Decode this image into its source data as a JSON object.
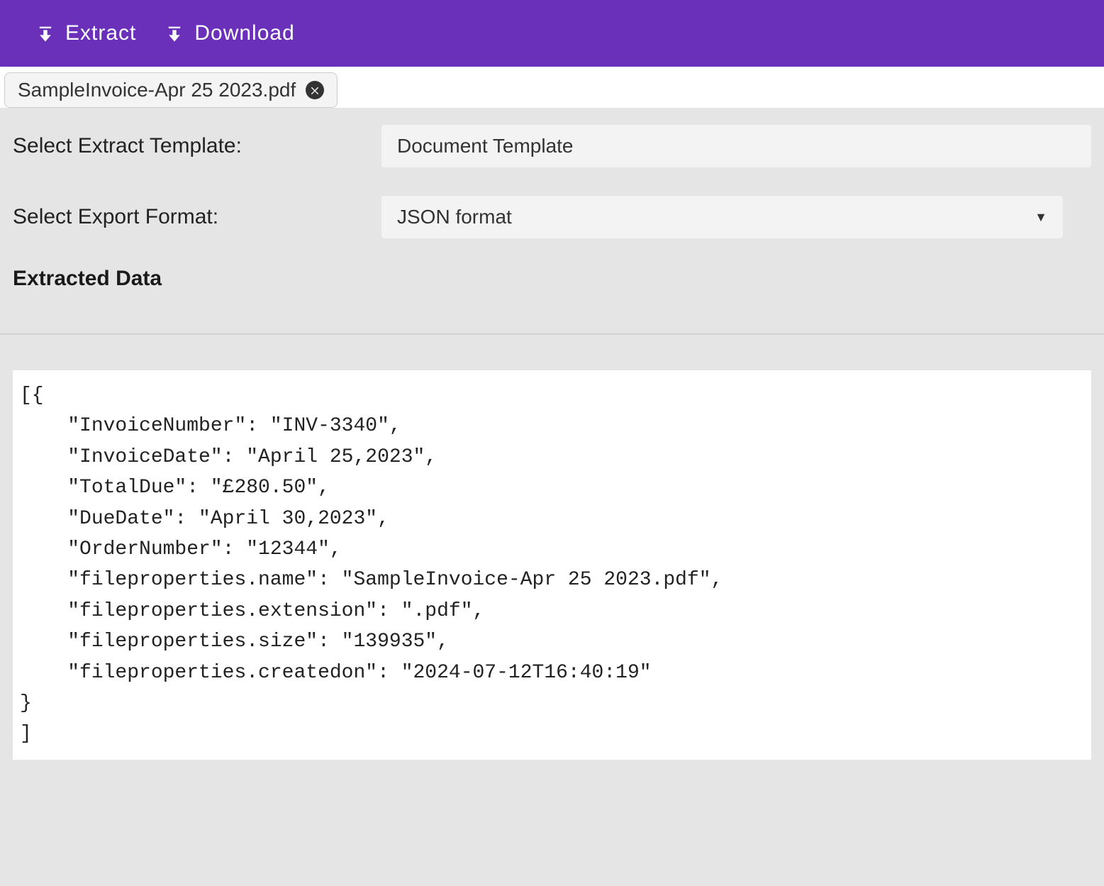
{
  "toolbar": {
    "extract_label": "Extract",
    "download_label": "Download"
  },
  "file_tab": {
    "filename": "SampleInvoice-Apr 25 2023.pdf"
  },
  "config": {
    "template_label": "Select Extract Template:",
    "template_value": "Document Template",
    "export_label": "Select Export Format:",
    "export_value": "JSON format",
    "section_heading": "Extracted Data"
  },
  "output_text": "[{\n    \"InvoiceNumber\": \"INV-3340\",\n    \"InvoiceDate\": \"April 25,2023\",\n    \"TotalDue\": \"£280.50\",\n    \"DueDate\": \"April 30,2023\",\n    \"OrderNumber\": \"12344\",\n    \"fileproperties.name\": \"SampleInvoice-Apr 25 2023.pdf\",\n    \"fileproperties.extension\": \".pdf\",\n    \"fileproperties.size\": \"139935\",\n    \"fileproperties.createdon\": \"2024-07-12T16:40:19\"\n}\n]"
}
